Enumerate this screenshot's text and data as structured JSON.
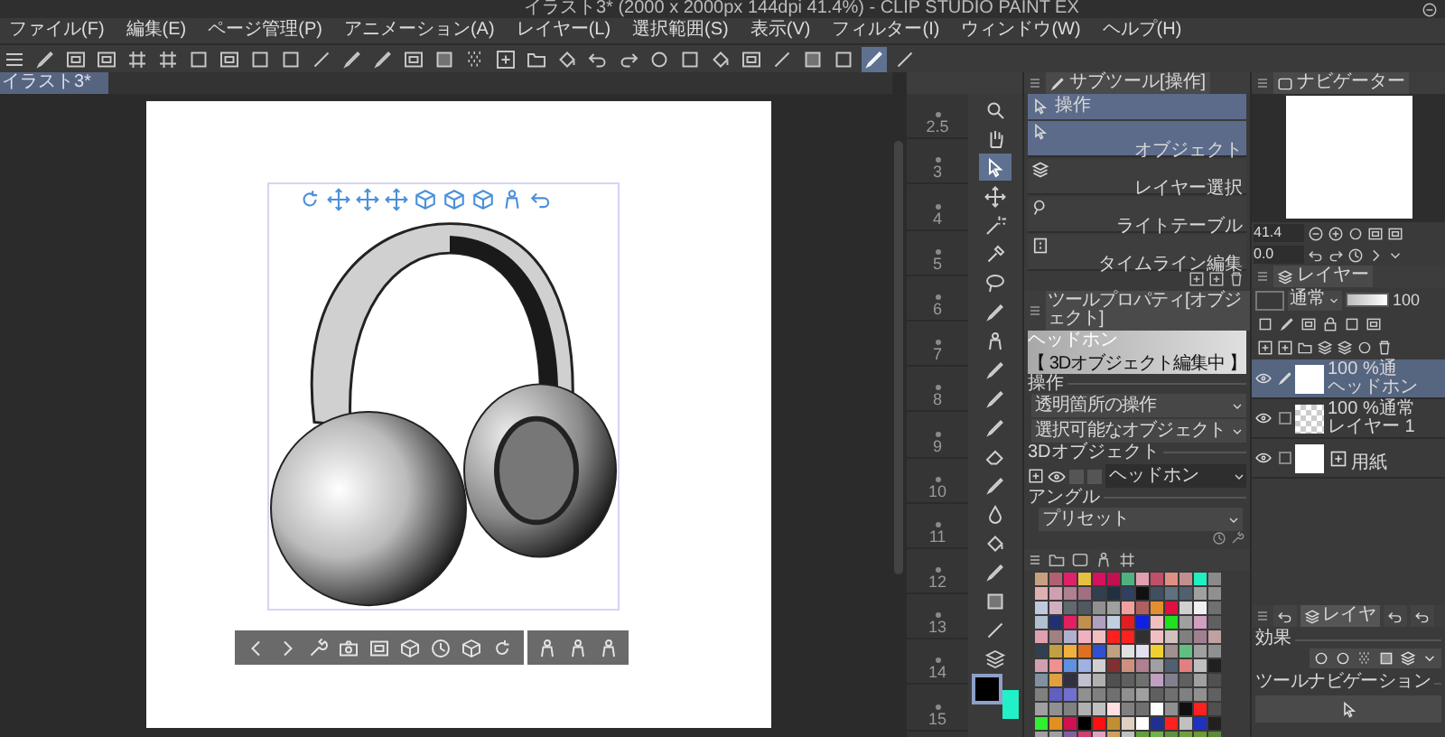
{
  "window": {
    "title": "イラスト3* (2000 x 2000px 144dpi 41.4%) - CLIP STUDIO PAINT EX"
  },
  "menu": [
    "ファイル(F)",
    "編集(E)",
    "ページ管理(P)",
    "アニメーション(A)",
    "レイヤー(L)",
    "選択範囲(S)",
    "表示(V)",
    "フィルター(I)",
    "ウィンドウ(W)",
    "ヘルプ(H)"
  ],
  "toolbar": [
    {
      "kind": "menu",
      "selected": false
    },
    {
      "kind": "pen",
      "selected": false
    },
    {
      "kind": "frame",
      "selected": false
    },
    {
      "kind": "frame",
      "selected": false
    },
    {
      "kind": "grid",
      "selected": false
    },
    {
      "kind": "grid",
      "selected": false
    },
    {
      "kind": "square",
      "selected": false
    },
    {
      "kind": "frame",
      "selected": false
    },
    {
      "kind": "square",
      "selected": false
    },
    {
      "kind": "square",
      "selected": false
    },
    {
      "kind": "line",
      "selected": false
    },
    {
      "kind": "pen",
      "selected": false
    },
    {
      "kind": "pen",
      "selected": false
    },
    {
      "kind": "frame",
      "selected": false
    },
    {
      "kind": "gradient",
      "selected": false
    },
    {
      "kind": "checker",
      "selected": false
    },
    {
      "kind": "new",
      "selected": false
    },
    {
      "kind": "folder",
      "selected": false
    },
    {
      "kind": "bucket",
      "selected": false
    },
    {
      "kind": "undo",
      "selected": false
    },
    {
      "kind": "redo",
      "selected": false
    },
    {
      "kind": "circle",
      "selected": false
    },
    {
      "kind": "square",
      "selected": false
    },
    {
      "kind": "bucket",
      "selected": false
    },
    {
      "kind": "frame",
      "selected": false
    },
    {
      "kind": "line",
      "selected": false
    },
    {
      "kind": "gradient",
      "selected": false
    },
    {
      "kind": "square",
      "selected": false
    },
    {
      "kind": "pen",
      "selected": true
    },
    {
      "kind": "line",
      "selected": false
    }
  ],
  "document_tab": {
    "title": "イラスト3*",
    "selected": true
  },
  "timeline": {
    "frames": [
      "2.5",
      "3",
      "4",
      "5",
      "6",
      "7",
      "8",
      "9",
      "10",
      "11",
      "12",
      "13",
      "14",
      "15"
    ]
  },
  "tools": [
    {
      "kind": "search",
      "selected": false
    },
    {
      "kind": "hand",
      "selected": false
    },
    {
      "kind": "cursor",
      "selected": true
    },
    {
      "kind": "move",
      "selected": false
    },
    {
      "kind": "wand",
      "selected": false
    },
    {
      "kind": "dropper",
      "selected": false
    },
    {
      "kind": "lasso",
      "selected": false
    },
    {
      "kind": "pen",
      "selected": false
    },
    {
      "kind": "figure",
      "selected": false
    },
    {
      "kind": "pen",
      "selected": false
    },
    {
      "kind": "pen",
      "selected": false
    },
    {
      "kind": "pen",
      "selected": false
    },
    {
      "kind": "eraser",
      "selected": false
    },
    {
      "kind": "pen",
      "selected": false
    },
    {
      "kind": "drop",
      "selected": false
    },
    {
      "kind": "bucket",
      "selected": false
    },
    {
      "kind": "pen",
      "selected": false
    },
    {
      "kind": "gradient",
      "selected": false
    },
    {
      "kind": "line",
      "selected": false
    },
    {
      "kind": "layers",
      "selected": false
    }
  ],
  "colors": {
    "main": {
      "color": "#000000"
    },
    "sub": {
      "color": "#22f0c8"
    }
  },
  "sub_tool": {
    "title": "サブツール[操作]",
    "group": {
      "label": "操作",
      "selected": true
    },
    "items": [
      {
        "label": "オブジェクト",
        "kind": "cursor",
        "selected": true
      },
      {
        "label": "レイヤー選択",
        "kind": "layers",
        "selected": false
      },
      {
        "label": "ライトテーブル",
        "kind": "bulb",
        "selected": false
      },
      {
        "label": "タイムライン編集",
        "kind": "film",
        "selected": false
      }
    ]
  },
  "tool_property": {
    "title": "ツールプロパティ[オブジェクト]",
    "preview_label": "ヘッドホン",
    "status": "【 3Dオブジェクト編集中 】",
    "section_1": "操作",
    "dropdowns": [
      "透明箇所の操作",
      "選択可能なオブジェクト"
    ],
    "section_2": "3Dオブジェクト",
    "toggles": [
      {
        "on": false
      },
      {
        "on": false
      }
    ],
    "object_select": "ヘッドホン",
    "section_3": "アングル",
    "preset": "プリセット"
  },
  "palette": [
    {
      "color": "#c8a080"
    },
    {
      "color": "#b06070"
    },
    {
      "color": "#e0206a"
    },
    {
      "color": "#e8c040"
    },
    {
      "color": "#d81060"
    },
    {
      "color": "#c01050"
    },
    {
      "color": "#50b080"
    },
    {
      "color": "#e0a0b0"
    },
    {
      "color": "#c0506a"
    },
    {
      "color": "#e09080"
    },
    {
      "color": "#c09090"
    },
    {
      "color": "#20f0c0"
    },
    {
      "color": "#8a8a8a"
    },
    {
      "color": "#e0b0b0"
    },
    {
      "color": "#d0a0b0"
    },
    {
      "color": "#b08090"
    },
    {
      "color": "#a07080"
    },
    {
      "color": "#304050"
    },
    {
      "color": "#203040"
    },
    {
      "color": "#304060"
    },
    {
      "color": "#101010"
    },
    {
      "color": "#405060"
    },
    {
      "color": "#607080"
    },
    {
      "color": "#506070"
    },
    {
      "color": "#a0a0a0"
    },
    {
      "color": "#909090"
    },
    {
      "color": "#c0c8e0"
    },
    {
      "color": "#d0b0c0"
    },
    {
      "color": "#606870"
    },
    {
      "color": "#505860"
    },
    {
      "color": "#909090"
    },
    {
      "color": "#a0a0a0"
    },
    {
      "color": "#f0a0a0"
    },
    {
      "color": "#b06060"
    },
    {
      "color": "#e09030"
    },
    {
      "color": "#e01040"
    },
    {
      "color": "#d0d0d0"
    },
    {
      "color": "#f0f0f0"
    },
    {
      "color": "#707070"
    },
    {
      "color": "#b0c0d0"
    },
    {
      "color": "#203070"
    },
    {
      "color": "#e02060"
    },
    {
      "color": "#c09050"
    },
    {
      "color": "#b0a0c0"
    },
    {
      "color": "#c0d0e0"
    },
    {
      "color": "#e02020"
    },
    {
      "color": "#1020e0"
    },
    {
      "color": "#f0c0c0"
    },
    {
      "color": "#20e020"
    },
    {
      "color": "#a0a0a0"
    },
    {
      "color": "#d0a0c0"
    },
    {
      "color": "#606060"
    },
    {
      "color": "#e0a0b0"
    },
    {
      "color": "#a08080"
    },
    {
      "color": "#b0b0d0"
    },
    {
      "color": "#f0b0c0"
    },
    {
      "color": "#f0c0c0"
    },
    {
      "color": "#ff2020"
    },
    {
      "color": "#ff2020"
    },
    {
      "color": "#303030"
    },
    {
      "color": "#f0c0c0"
    },
    {
      "color": "#d0c0c0"
    },
    {
      "color": "#808080"
    },
    {
      "color": "#a08090"
    },
    {
      "color": "#c0a0a0"
    },
    {
      "color": "#304050"
    },
    {
      "color": "#c0a040"
    },
    {
      "color": "#f0b040"
    },
    {
      "color": "#e07020"
    },
    {
      "color": "#3050d0"
    },
    {
      "color": "#c0a080"
    },
    {
      "color": "#e0e0e0"
    },
    {
      "color": "#e0e0f0"
    },
    {
      "color": "#f0d030"
    },
    {
      "color": "#a09090"
    },
    {
      "color": "#60c080"
    },
    {
      "color": "#a0a0a0"
    },
    {
      "color": "#909090"
    },
    {
      "color": "#d0a0b0"
    },
    {
      "color": "#f09090"
    },
    {
      "color": "#6090e0"
    },
    {
      "color": "#a0b0e0"
    },
    {
      "color": "#d0d0d0"
    },
    {
      "color": "#803030"
    },
    {
      "color": "#d09080"
    },
    {
      "color": "#b08090"
    },
    {
      "color": "#a0a0a0"
    },
    {
      "color": "#506070"
    },
    {
      "color": "#e08080"
    },
    {
      "color": "#c0c0c0"
    },
    {
      "color": "#202020"
    },
    {
      "color": "#8090a0"
    },
    {
      "color": "#e0a040"
    },
    {
      "color": "#303040"
    },
    {
      "color": "#c0c0d0"
    },
    {
      "color": "#b0b0b0"
    },
    {
      "color": "#505050"
    },
    {
      "color": "#606060"
    },
    {
      "color": "#707070"
    },
    {
      "color": "#c0a0c0"
    },
    {
      "color": "#808090"
    },
    {
      "color": "#606060"
    },
    {
      "color": "#a0a0a0"
    },
    {
      "color": "#505050"
    },
    {
      "color": "#808080"
    },
    {
      "color": "#6060c0"
    },
    {
      "color": "#7070d0"
    },
    {
      "color": "#909090"
    },
    {
      "color": "#808080"
    },
    {
      "color": "#707070"
    },
    {
      "color": "#909090"
    },
    {
      "color": "#a0a0a0"
    },
    {
      "color": "#606060"
    },
    {
      "color": "#707070"
    },
    {
      "color": "#808080"
    },
    {
      "color": "#909090"
    },
    {
      "color": "#606060"
    },
    {
      "color": "#a0a0a0"
    },
    {
      "color": "#909090"
    },
    {
      "color": "#808080"
    },
    {
      "color": "#b0b0b0"
    },
    {
      "color": "#c0c0c0"
    },
    {
      "color": "#ffe0e0"
    },
    {
      "color": "#808080"
    },
    {
      "color": "#707070"
    },
    {
      "color": "#ffffff"
    },
    {
      "color": "#909090"
    },
    {
      "color": "#101010"
    },
    {
      "color": "#ff2020"
    },
    {
      "color": "#505050"
    },
    {
      "color": "#30f030"
    },
    {
      "color": "#e09020"
    },
    {
      "color": "#d01050"
    },
    {
      "color": "#000000"
    },
    {
      "color": "#ff1010"
    },
    {
      "color": "#c09030"
    },
    {
      "color": "#e0d0c0"
    },
    {
      "color": "#ffffff"
    },
    {
      "color": "#203090"
    },
    {
      "color": "#ff2020"
    },
    {
      "color": "#c0c0c0"
    },
    {
      "color": "#2030c0"
    },
    {
      "color": "#202020"
    },
    {
      "color": "#a0a0a0"
    },
    {
      "color": "#a0a0a0"
    },
    {
      "color": "#8060a0"
    },
    {
      "color": "#d04070"
    },
    {
      "color": "#e0a0c0"
    },
    {
      "color": "#d0a060"
    },
    {
      "color": "#c0c0c0"
    },
    {
      "color": "#60a040"
    },
    {
      "color": "#70b050"
    },
    {
      "color": "#609040"
    },
    {
      "color": "#70a040"
    },
    {
      "color": "#6a9a3a"
    },
    {
      "color": "#5a8a3a"
    }
  ],
  "navigator": {
    "title": "ナビゲーター",
    "zoom": "41.4",
    "rotation": "0.0"
  },
  "layers": {
    "title": "レイヤー",
    "blend_mode": "通常",
    "opacity": "100",
    "opacity_slider": {
      "level": 1
    },
    "items": [
      {
        "kind": "model",
        "mode": "100 %通",
        "name": "ヘッドホン",
        "selected": true,
        "visible": true,
        "editing": true
      },
      {
        "kind": "raster",
        "mode": "100 %通常",
        "name": "レイヤー 1",
        "selected": false,
        "visible": true,
        "editing": false
      },
      {
        "kind": "paper",
        "name": "用紙",
        "selected": false,
        "visible": true,
        "editing": false
      }
    ]
  },
  "lower_tabs": [
    {
      "kind": "icon",
      "selected": false
    },
    {
      "kind": "label",
      "label": "レイヤ",
      "selected": true
    },
    {
      "kind": "icon",
      "selected": false
    },
    {
      "kind": "icon",
      "selected": false
    }
  ],
  "effects": {
    "title": "効果"
  },
  "tool_navigation": {
    "title": "ツールナビゲーション"
  }
}
